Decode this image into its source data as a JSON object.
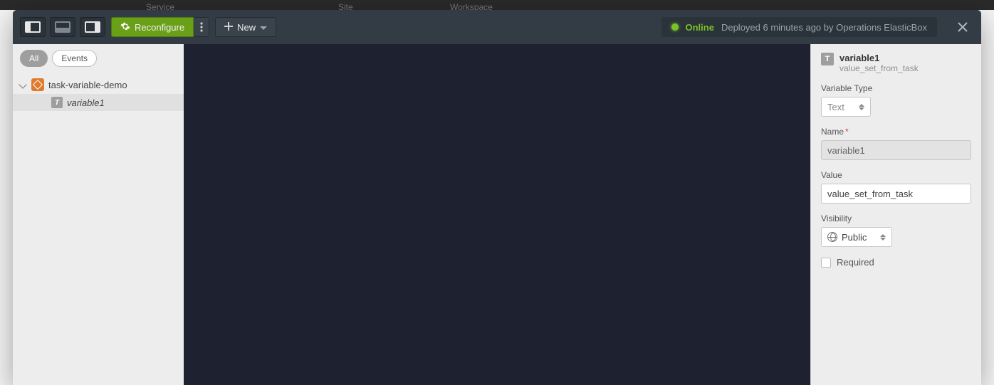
{
  "backdrop_tabs": {
    "service": "Service",
    "site": "Site",
    "workspace": "Workspace"
  },
  "toolbar": {
    "reconfigure_label": "Reconfigure",
    "new_label": "New"
  },
  "status": {
    "state": "Online",
    "deploy_text": "Deployed 6 minutes ago by Operations ElasticBox"
  },
  "sidebar": {
    "filters": {
      "all": "All",
      "events": "Events"
    },
    "tree": {
      "parent": "task-variable-demo",
      "child": "variable1"
    }
  },
  "inspector": {
    "title": "variable1",
    "subtitle": "value_set_from_task",
    "type_label": "Variable Type",
    "type_value": "Text",
    "name_label": "Name",
    "name_value": "variable1",
    "value_label": "Value",
    "value_value": "value_set_from_task",
    "visibility_label": "Visibility",
    "visibility_value": "Public",
    "required_label": "Required"
  }
}
